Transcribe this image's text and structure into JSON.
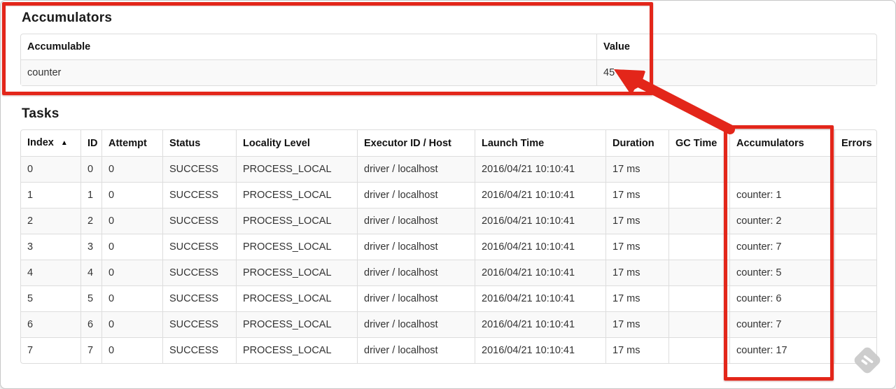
{
  "accumulators_section": {
    "heading": "Accumulators",
    "table": {
      "headers": [
        "Accumulable",
        "Value"
      ],
      "rows": [
        [
          "counter",
          "45"
        ]
      ]
    }
  },
  "tasks_section": {
    "heading": "Tasks",
    "table": {
      "headers": [
        "Index",
        "ID",
        "Attempt",
        "Status",
        "Locality Level",
        "Executor ID / Host",
        "Launch Time",
        "Duration",
        "GC Time",
        "Accumulators",
        "Errors"
      ],
      "sort_column": "Index",
      "sort_indicator": "▲",
      "rows": [
        [
          "0",
          "0",
          "0",
          "SUCCESS",
          "PROCESS_LOCAL",
          "driver / localhost",
          "2016/04/21 10:10:41",
          "17 ms",
          "",
          "",
          ""
        ],
        [
          "1",
          "1",
          "0",
          "SUCCESS",
          "PROCESS_LOCAL",
          "driver / localhost",
          "2016/04/21 10:10:41",
          "17 ms",
          "",
          "counter: 1",
          ""
        ],
        [
          "2",
          "2",
          "0",
          "SUCCESS",
          "PROCESS_LOCAL",
          "driver / localhost",
          "2016/04/21 10:10:41",
          "17 ms",
          "",
          "counter: 2",
          ""
        ],
        [
          "3",
          "3",
          "0",
          "SUCCESS",
          "PROCESS_LOCAL",
          "driver / localhost",
          "2016/04/21 10:10:41",
          "17 ms",
          "",
          "counter: 7",
          ""
        ],
        [
          "4",
          "4",
          "0",
          "SUCCESS",
          "PROCESS_LOCAL",
          "driver / localhost",
          "2016/04/21 10:10:41",
          "17 ms",
          "",
          "counter: 5",
          ""
        ],
        [
          "5",
          "5",
          "0",
          "SUCCESS",
          "PROCESS_LOCAL",
          "driver / localhost",
          "2016/04/21 10:10:41",
          "17 ms",
          "",
          "counter: 6",
          ""
        ],
        [
          "6",
          "6",
          "0",
          "SUCCESS",
          "PROCESS_LOCAL",
          "driver / localhost",
          "2016/04/21 10:10:41",
          "17 ms",
          "",
          "counter: 7",
          ""
        ],
        [
          "7",
          "7",
          "0",
          "SUCCESS",
          "PROCESS_LOCAL",
          "driver / localhost",
          "2016/04/21 10:10:41",
          "17 ms",
          "",
          "counter: 17",
          ""
        ]
      ]
    }
  },
  "annotations": {
    "highlight_color": "#e3261a",
    "box_accumulators_section": "red box around Accumulators summary",
    "box_accumulators_column": "red box around Accumulators task column",
    "arrow": "arrow from Accumulators column to value 45",
    "watermark_icon": "skitch-watermark-icon"
  }
}
